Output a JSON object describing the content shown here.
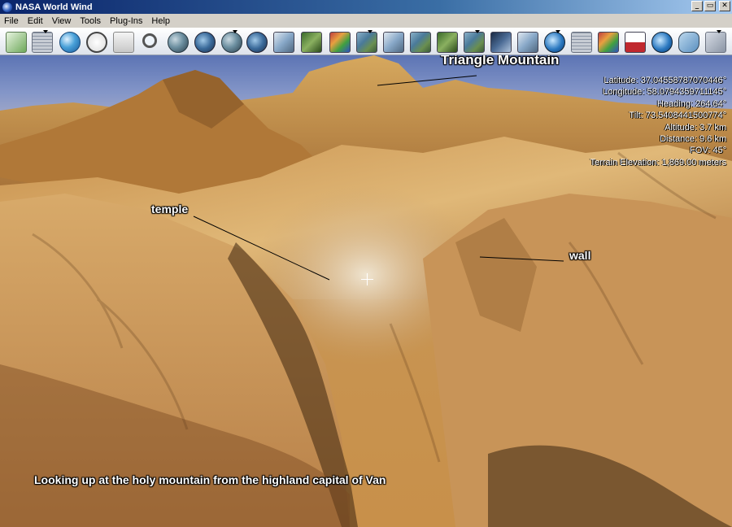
{
  "window": {
    "title": "NASA World Wind"
  },
  "window_controls": {
    "minimize": "_",
    "maximize": "▭",
    "close": "✕"
  },
  "menu": [
    "File",
    "Edit",
    "View",
    "Tools",
    "Plug-Ins",
    "Help"
  ],
  "toolbar": {
    "icons": [
      "layers-icon",
      "placenames-grid-icon",
      "latlon-grid-icon",
      "clock-icon",
      "document-icon",
      "search-icon",
      "earth-icon",
      "earth-dropdown-icon",
      "world-add-icon",
      "landsat-icon",
      "srtm-icon",
      "modis-icon",
      "geocover-icon",
      "rapidfire-icon",
      "scanned-map-icon",
      "usgs-icon",
      "nlt-landsat-icon",
      "topo-map-icon",
      "satellite-dropdown-icon",
      "usgs-grid-icon",
      "flag-icon",
      "disaster-icon",
      "globe-coin-icon",
      "usa-map-icon",
      "settings-dropdown-icon"
    ]
  },
  "viewport": {
    "labels": {
      "triangle_mountain": "Triangle Mountain",
      "temple": "temple",
      "wall": "wall",
      "caption": "Looking up at the holy mountain from the highland capital of Van"
    },
    "info": {
      "latitude": "Latitude: 37.04558787070446°",
      "longitude": "Longitude: 58.0794359711145°",
      "heading": "Heading: 264.64°",
      "tilt": "Tilt: 73.5408441500774°",
      "altitude": "Altitude: 3.7 km",
      "distance": "Distance: 9.6 km",
      "fov": "FOV: 45°",
      "terrain_elevation": "Terrain Elevation: 1,869.00 meters"
    }
  },
  "colors": {
    "sky": "#7f92c4",
    "terrain_base": "#c28e4a",
    "terrain_light": "#e0c08a",
    "terrain_dark": "#5a3a1a"
  }
}
